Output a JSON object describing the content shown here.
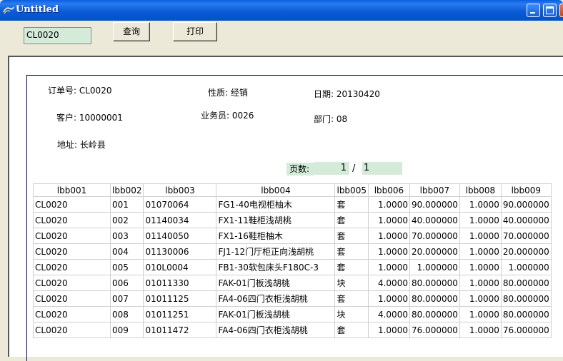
{
  "window": {
    "title": "Untitled"
  },
  "toolbar": {
    "order_value": "CL0020",
    "query_label": "查询",
    "print_label": "打印"
  },
  "report": {
    "order_no": "订单号: CL0020",
    "nature": "性质: 经销",
    "date": "日期: 20130420",
    "customer": "客户: 10000001",
    "salesman": "业务员: 0026",
    "department": "部门: 08",
    "address": "地址: 长岭县",
    "page_label": "页数:",
    "page_current": "1",
    "page_sep": "/",
    "page_total": "1"
  },
  "table": {
    "headers": [
      "lbb001",
      "lbb002",
      "lbb003",
      "lbb004",
      "lbb005",
      "lbb006",
      "lbb007",
      "lbb008",
      "lbb009"
    ],
    "rows": [
      [
        "CL0020",
        "001",
        "01070064",
        "FG1-40电视柜柚木",
        "套",
        "1.0000",
        "90.000000",
        "1.0000",
        "90.000000"
      ],
      [
        "CL0020",
        "002",
        "01140034",
        "FX1-11鞋柜浅胡桃",
        "套",
        "1.0000",
        "40.000000",
        "1.0000",
        "40.000000"
      ],
      [
        "CL0020",
        "003",
        "01140050",
        "FX1-16鞋柜柚木",
        "套",
        "1.0000",
        "70.000000",
        "1.0000",
        "70.000000"
      ],
      [
        "CL0020",
        "004",
        "01130006",
        "FJ1-12门厅柜正向浅胡桃",
        "套",
        "1.0000",
        "20.000000",
        "1.0000",
        "20.000000"
      ],
      [
        "CL0020",
        "005",
        "010L0004",
        "FB1-30软包床头F180C-3",
        "套",
        "1.0000",
        "1.000000",
        "1.0000",
        "1.000000"
      ],
      [
        "CL0020",
        "006",
        "01011330",
        "FAK-01门板浅胡桃",
        "块",
        "4.0000",
        "80.000000",
        "1.0000",
        "80.000000"
      ],
      [
        "CL0020",
        "007",
        "01011125",
        "FA4-06四门衣柜浅胡桃",
        "套",
        "1.0000",
        "80.000000",
        "1.0000",
        "80.000000"
      ],
      [
        "CL0020",
        "008",
        "01011251",
        "FAK-01门板浅胡桃",
        "块",
        "4.0000",
        "80.000000",
        "1.0000",
        "80.000000"
      ],
      [
        "CL0020",
        "009",
        "01011472",
        "FA4-06四门衣柜浅胡桃",
        "套",
        "1.0000",
        "76.000000",
        "1.0000",
        "76.000000"
      ]
    ]
  },
  "icons": {
    "app": "app-icon",
    "minimize": "minimize-icon",
    "maximize": "maximize-icon",
    "close": "close-icon"
  }
}
